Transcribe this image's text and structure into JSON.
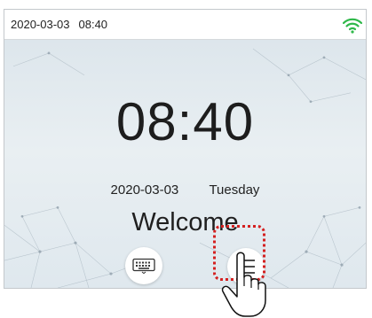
{
  "status_bar": {
    "date": "2020-03-03",
    "time": "08:40",
    "wifi_icon": "wifi-icon",
    "wifi_color": "#2fb84a"
  },
  "home": {
    "clock": "08:40",
    "date": "2020-03-03",
    "weekday": "Tuesday",
    "greeting": "Welcome"
  },
  "buttons": {
    "keyboard_icon": "keyboard-icon",
    "menu_icon": "menu-icon"
  },
  "annotation": {
    "highlight_color": "#d42020",
    "pointer_icon": "hand-pointer-icon"
  }
}
